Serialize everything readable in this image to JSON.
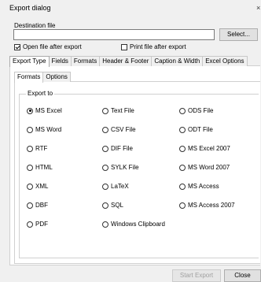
{
  "window": {
    "title": "Export dialog",
    "close_glyph": "×"
  },
  "destination": {
    "label": "Destination file",
    "value": "",
    "select_label": "Select..."
  },
  "options": {
    "open_after": {
      "label": "Open file after export",
      "checked": true
    },
    "print_after": {
      "label": "Print file after export",
      "checked": false
    }
  },
  "tabs": [
    "Export Type",
    "Fields",
    "Formats",
    "Header & Footer",
    "Caption & Width",
    "Excel Options"
  ],
  "subtabs": [
    "Formats",
    "Options"
  ],
  "export_to": {
    "label": "Export to",
    "formats": [
      "MS Excel",
      "Text File",
      "ODS File",
      "MS Word",
      "CSV File",
      "ODT File",
      "RTF",
      "DIF File",
      "MS Excel 2007",
      "HTML",
      "SYLK File",
      "MS Word 2007",
      "XML",
      "LaTeX",
      "MS Access",
      "DBF",
      "SQL",
      "MS Access 2007",
      "PDF",
      "Windows Clipboard"
    ],
    "selected": "MS Excel"
  },
  "footer": {
    "start_label": "Start Export",
    "close_label": "Close"
  }
}
